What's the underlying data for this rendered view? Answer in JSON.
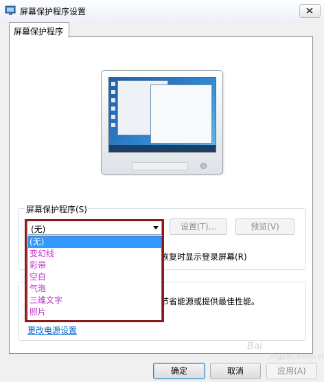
{
  "window": {
    "title": "屏幕保护程序设置"
  },
  "tab": {
    "label": "屏幕保护程序"
  },
  "screensaver_group": {
    "label": "屏幕保护程序(S)",
    "selected": "(无)",
    "settings_button": "设置(T)...",
    "preview_button": "预览(V)",
    "resume_text": "恢复时显示登录屏幕(R)"
  },
  "dropdown": {
    "options": [
      "(无)",
      "变幻线",
      "彩带",
      "空白",
      "气泡",
      "三维文字",
      "照片"
    ],
    "selected_index": 0
  },
  "power_group": {
    "text": "节省能源或提供最佳性能。",
    "link": "更改电源设置"
  },
  "buttons": {
    "ok": "确定",
    "cancel": "取消",
    "apply": "应用(A)"
  },
  "watermark": {
    "brand": "Bai",
    "sub": "jingyan.baidu.com"
  },
  "colors": {
    "highlight": "#8a1a1a",
    "dropdown_text": "#c02fc8",
    "selection": "#3399ff",
    "link": "#0066cc"
  }
}
